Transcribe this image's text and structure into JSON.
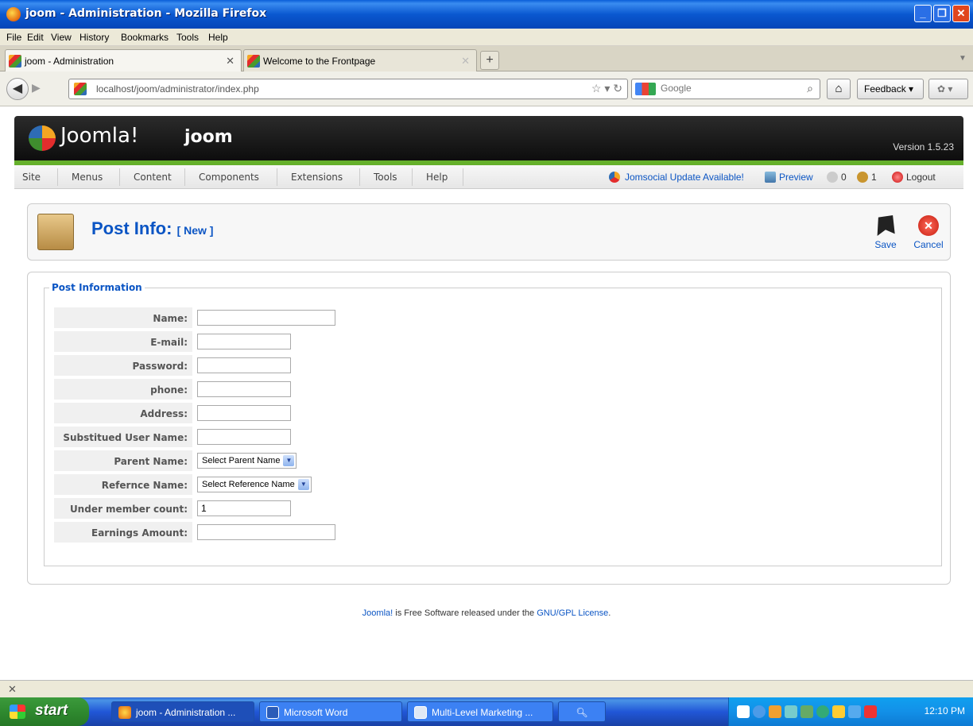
{
  "window": {
    "title": "joom - Administration - Mozilla Firefox"
  },
  "menubar": [
    "File",
    "Edit",
    "View",
    "History",
    "Bookmarks",
    "Tools",
    "Help"
  ],
  "tabs": [
    {
      "label": "joom - Administration",
      "active": true
    },
    {
      "label": "Welcome to the Frontpage",
      "active": false
    }
  ],
  "nav": {
    "url": "localhost/joom/administrator/index.php",
    "search_placeholder": "Google",
    "feedback_label": "Feedback"
  },
  "joomla": {
    "brand": "Joomla!",
    "site_name": "joom",
    "version": "Version 1.5.23",
    "menu": [
      "Site",
      "Menus",
      "Content",
      "Components",
      "Extensions",
      "Tools",
      "Help"
    ],
    "status": {
      "update": "Jomsocial Update Available!",
      "preview": "Preview",
      "messages": "0",
      "users": "1",
      "logout": "Logout"
    }
  },
  "toolbar": {
    "title": "Post Info:",
    "subtitle": "[ New ]",
    "save_label": "Save",
    "cancel_label": "Cancel"
  },
  "form": {
    "legend": "Post Information",
    "fields": [
      {
        "label": "Name:",
        "value": ""
      },
      {
        "label": "E-mail:",
        "value": ""
      },
      {
        "label": "Password:",
        "value": ""
      },
      {
        "label": "phone:",
        "value": ""
      },
      {
        "label": "Address:",
        "value": ""
      },
      {
        "label": "Substitued User Name:",
        "value": ""
      },
      {
        "label": "Parent Name:",
        "selected": "Select Parent Name"
      },
      {
        "label": "Refernce Name:",
        "selected": "Select Reference Name"
      },
      {
        "label": "Under member count:",
        "value": "1"
      },
      {
        "label": "Earnings Amount:",
        "value": ""
      }
    ]
  },
  "footer": {
    "joomla_link": "Joomla!",
    "text": " is Free Software released under the ",
    "license_link": "GNU/GPL License",
    "end": "."
  },
  "taskbar": {
    "start_label": "start",
    "tasks": [
      "joom - Administration ...",
      "Microsoft Word",
      "Multi-Level Marketing ..."
    ],
    "clock": "12:10 PM"
  }
}
